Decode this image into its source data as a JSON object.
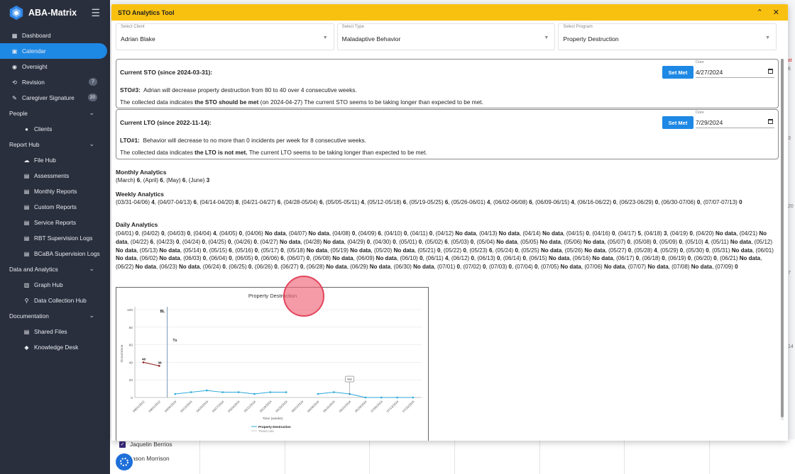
{
  "app": {
    "name": "ABA-Matrix"
  },
  "sidebar": {
    "items": [
      {
        "label": "Dashboard",
        "icon": "dashboard-icon",
        "kind": "top"
      },
      {
        "label": "Calendar",
        "icon": "calendar-icon",
        "kind": "top",
        "active": true
      },
      {
        "label": "Oversight",
        "icon": "eye-icon",
        "kind": "top"
      },
      {
        "label": "Revision",
        "icon": "revision-icon",
        "kind": "top",
        "badge": "7"
      },
      {
        "label": "Caregiver Signature",
        "icon": "signature-icon",
        "kind": "top",
        "badge": "20"
      },
      {
        "label": "People",
        "kind": "group",
        "chevron": "⌄"
      },
      {
        "label": "Clients",
        "icon": "people-icon",
        "kind": "sub"
      },
      {
        "label": "Report Hub",
        "kind": "group",
        "chevron": "⌄"
      },
      {
        "label": "File Hub",
        "icon": "cloud-icon",
        "kind": "sub"
      },
      {
        "label": "Assessments",
        "icon": "doc-icon",
        "kind": "sub"
      },
      {
        "label": "Monthly Reports",
        "icon": "report-icon",
        "kind": "sub"
      },
      {
        "label": "Custom Reports",
        "icon": "report-icon",
        "kind": "sub"
      },
      {
        "label": "Service Reports",
        "icon": "report-icon",
        "kind": "sub"
      },
      {
        "label": "RBT Supervision Logs",
        "icon": "report-icon",
        "kind": "sub"
      },
      {
        "label": "BCaBA Supervision Logs",
        "icon": "report-icon",
        "kind": "sub"
      },
      {
        "label": "Data and Analytics",
        "kind": "group",
        "chevron": "⌄"
      },
      {
        "label": "Graph Hub",
        "icon": "graph-icon",
        "kind": "sub"
      },
      {
        "label": "Data Collection Hub",
        "icon": "data-icon",
        "kind": "sub"
      },
      {
        "label": "Documentation",
        "kind": "group",
        "chevron": "⌄"
      },
      {
        "label": "Shared Files",
        "icon": "file-icon",
        "kind": "sub"
      },
      {
        "label": "Knowledge Desk",
        "icon": "graduation-icon",
        "kind": "sub"
      }
    ]
  },
  "background": {
    "staff": [
      "Jaquelin Berrios",
      "ason Morrison"
    ],
    "edge_labels": [
      "at",
      "6",
      "3",
      "20",
      "7",
      "14"
    ]
  },
  "modal": {
    "title": "STO Analytics Tool",
    "collapse_icon": "⌃",
    "close_icon": "✕",
    "selects": [
      {
        "label": "Select Client",
        "value": "Adrian Blake"
      },
      {
        "label": "Select Type",
        "value": "Maladaptive Behavior"
      },
      {
        "label": "Select Program",
        "value": "Property Destruction"
      }
    ],
    "sto": {
      "title": "Current STO (since 2024-03-31):",
      "code": "STO#3:",
      "goal": "Adrian will decrease property destruction from 80 to 40 over 4 consecutive weeks.",
      "status_prefix": "The collected data indicates ",
      "status_bold": "the STO should be met",
      "status_suffix": " (on 2024-04-27) The current STO seems to be taking longer than expected to be met.",
      "button": "Set Met",
      "date_label": "Date",
      "date_value": "4/27/2024"
    },
    "lto": {
      "title": "Current LTO (since 2022-11-14):",
      "code": "LTO#1:",
      "goal": "Behavior will decrease to no more than 0 incidents per week for 8 consecutive weeks.",
      "status_prefix": "The collected data indicates ",
      "status_bold": "the LTO is not met.",
      "status_suffix": " The current LTO seems to be taking longer than expected to be met.",
      "button": "Set Met",
      "date_label": "Date",
      "date_value": "7/29/2024"
    },
    "monthly": {
      "title": "Monthly Analytics",
      "entries": [
        {
          "k": "(March)",
          "v": "6"
        },
        {
          "k": "(April)",
          "v": "6"
        },
        {
          "k": "(May)",
          "v": "6"
        },
        {
          "k": "(June)",
          "v": "3"
        }
      ]
    },
    "weekly": {
      "title": "Weekly Analytics",
      "entries": [
        {
          "k": "(03/31-04/06)",
          "v": "4"
        },
        {
          "k": "(04/07-04/13)",
          "v": "6"
        },
        {
          "k": "(04/14-04/20)",
          "v": "8"
        },
        {
          "k": "(04/21-04/27)",
          "v": "6"
        },
        {
          "k": "(04/28-05/04)",
          "v": "6"
        },
        {
          "k": "(05/05-05/11)",
          "v": "4"
        },
        {
          "k": "(05/12-05/18)",
          "v": "6"
        },
        {
          "k": "(05/19-05/25)",
          "v": "6"
        },
        {
          "k": "(05/26-06/01)",
          "v": "4"
        },
        {
          "k": "(06/02-06/08)",
          "v": "6"
        },
        {
          "k": "(06/09-06/15)",
          "v": "4"
        },
        {
          "k": "(06/16-06/22)",
          "v": "0"
        },
        {
          "k": "(06/23-06/29)",
          "v": "0"
        },
        {
          "k": "(06/30-07/06)",
          "v": "0"
        },
        {
          "k": "(07/07-07/13)",
          "v": "0"
        }
      ]
    },
    "daily": {
      "title": "Daily Analytics",
      "entries": [
        {
          "k": "(04/01)",
          "v": "0"
        },
        {
          "k": "(04/02)",
          "v": "0"
        },
        {
          "k": "(04/03)",
          "v": "0"
        },
        {
          "k": "(04/04)",
          "v": "4"
        },
        {
          "k": "(04/05)",
          "v": "0"
        },
        {
          "k": "(04/06)",
          "v": "No data"
        },
        {
          "k": "(04/07)",
          "v": "No data"
        },
        {
          "k": "(04/08)",
          "v": "0"
        },
        {
          "k": "(04/09)",
          "v": "6"
        },
        {
          "k": "(04/10)",
          "v": "0"
        },
        {
          "k": "(04/11)",
          "v": "0"
        },
        {
          "k": "(04/12)",
          "v": "No data"
        },
        {
          "k": "(04/13)",
          "v": "No data"
        },
        {
          "k": "(04/14)",
          "v": "No data"
        },
        {
          "k": "(04/15)",
          "v": "0"
        },
        {
          "k": "(04/16)",
          "v": "0"
        },
        {
          "k": "(04/17)",
          "v": "5"
        },
        {
          "k": "(04/18)",
          "v": "3"
        },
        {
          "k": "(04/19)",
          "v": "0"
        },
        {
          "k": "(04/20)",
          "v": "No data"
        },
        {
          "k": "(04/21)",
          "v": "No data"
        },
        {
          "k": "(04/22)",
          "v": "6"
        },
        {
          "k": "(04/23)",
          "v": "0"
        },
        {
          "k": "(04/24)",
          "v": "0"
        },
        {
          "k": "(04/25)",
          "v": "0"
        },
        {
          "k": "(04/26)",
          "v": "0"
        },
        {
          "k": "(04/27)",
          "v": "No data"
        },
        {
          "k": "(04/28)",
          "v": "No data"
        },
        {
          "k": "(04/29)",
          "v": "0"
        },
        {
          "k": "(04/30)",
          "v": "0"
        },
        {
          "k": "(05/01)",
          "v": "0"
        },
        {
          "k": "(05/02)",
          "v": "6"
        },
        {
          "k": "(05/03)",
          "v": "0"
        },
        {
          "k": "(05/04)",
          "v": "No data"
        },
        {
          "k": "(05/05)",
          "v": "No data"
        },
        {
          "k": "(05/06)",
          "v": "No data"
        },
        {
          "k": "(05/07)",
          "v": "0"
        },
        {
          "k": "(05/08)",
          "v": "0"
        },
        {
          "k": "(05/09)",
          "v": "0"
        },
        {
          "k": "(05/10)",
          "v": "4"
        },
        {
          "k": "(05/11)",
          "v": "No data"
        },
        {
          "k": "(05/12)",
          "v": "No data"
        },
        {
          "k": "(05/13)",
          "v": "No data"
        },
        {
          "k": "(05/14)",
          "v": "0"
        },
        {
          "k": "(05/15)",
          "v": "6"
        },
        {
          "k": "(05/16)",
          "v": "0"
        },
        {
          "k": "(05/17)",
          "v": "0"
        },
        {
          "k": "(05/18)",
          "v": "No data"
        },
        {
          "k": "(05/19)",
          "v": "No data"
        },
        {
          "k": "(05/20)",
          "v": "No data"
        },
        {
          "k": "(05/21)",
          "v": "0"
        },
        {
          "k": "(05/22)",
          "v": "0"
        },
        {
          "k": "(05/23)",
          "v": "6"
        },
        {
          "k": "(05/24)",
          "v": "0"
        },
        {
          "k": "(05/25)",
          "v": "No data"
        },
        {
          "k": "(05/26)",
          "v": "No data"
        },
        {
          "k": "(05/27)",
          "v": "0"
        },
        {
          "k": "(05/28)",
          "v": "4"
        },
        {
          "k": "(05/29)",
          "v": "0"
        },
        {
          "k": "(05/30)",
          "v": "0"
        },
        {
          "k": "(05/31)",
          "v": "No data"
        },
        {
          "k": "(06/01)",
          "v": "No data"
        },
        {
          "k": "(06/02)",
          "v": "No data"
        },
        {
          "k": "(06/03)",
          "v": "0"
        },
        {
          "k": "(06/04)",
          "v": "0"
        },
        {
          "k": "(06/05)",
          "v": "0"
        },
        {
          "k": "(06/06)",
          "v": "6"
        },
        {
          "k": "(06/07)",
          "v": "0"
        },
        {
          "k": "(06/08)",
          "v": "No data"
        },
        {
          "k": "(06/09)",
          "v": "No data"
        },
        {
          "k": "(06/10)",
          "v": "0"
        },
        {
          "k": "(06/11)",
          "v": "4"
        },
        {
          "k": "(06/12)",
          "v": "0"
        },
        {
          "k": "(06/13)",
          "v": "0"
        },
        {
          "k": "(06/14)",
          "v": "0"
        },
        {
          "k": "(06/15)",
          "v": "No data"
        },
        {
          "k": "(06/16)",
          "v": "No data"
        },
        {
          "k": "(06/17)",
          "v": "0"
        },
        {
          "k": "(06/18)",
          "v": "0"
        },
        {
          "k": "(06/19)",
          "v": "0"
        },
        {
          "k": "(06/20)",
          "v": "0"
        },
        {
          "k": "(06/21)",
          "v": "No data"
        },
        {
          "k": "(06/22)",
          "v": "No data"
        },
        {
          "k": "(06/23)",
          "v": "No data"
        },
        {
          "k": "(06/24)",
          "v": "0"
        },
        {
          "k": "(06/25)",
          "v": "0"
        },
        {
          "k": "(06/26)",
          "v": "0"
        },
        {
          "k": "(06/27)",
          "v": "0"
        },
        {
          "k": "(06/28)",
          "v": "No data"
        },
        {
          "k": "(06/29)",
          "v": "No data"
        },
        {
          "k": "(06/30)",
          "v": "No data"
        },
        {
          "k": "(07/01)",
          "v": "0"
        },
        {
          "k": "(07/02)",
          "v": "0"
        },
        {
          "k": "(07/03)",
          "v": "0"
        },
        {
          "k": "(07/04)",
          "v": "0"
        },
        {
          "k": "(07/05)",
          "v": "No data"
        },
        {
          "k": "(07/06)",
          "v": "No data"
        },
        {
          "k": "(07/07)",
          "v": "No data"
        },
        {
          "k": "(07/08)",
          "v": "No data"
        },
        {
          "k": "(07/09)",
          "v": "0"
        }
      ]
    }
  },
  "chart_data": {
    "type": "line",
    "title": "Property Destruction",
    "xlabel": "Time (weeks)",
    "ylabel": "Occurrence",
    "ylim": [
      0,
      100
    ],
    "yticks": [
      0,
      20,
      40,
      60,
      80,
      100
    ],
    "x": [
      "08/01/2022",
      "09/01/2022",
      "04/06/2024",
      "04/13/2024",
      "04/20/2024",
      "04/27/2024",
      "05/04/2024",
      "05/11/2024",
      "05/18/2024",
      "05/25/2024",
      "06/01/2024",
      "06/08/2024",
      "06/15/2024",
      "06/22/2024",
      "06/29/2024",
      "07/06/2024",
      "07/13/2024",
      "07/20/2024"
    ],
    "phase_labels": [
      "BL",
      "Tx"
    ],
    "phase_line_after_index": 1,
    "series": [
      {
        "name": "Property Destruction",
        "color": "#2aa8d8",
        "start_index": 2,
        "values": [
          4,
          6,
          8,
          6,
          6,
          4,
          6,
          6,
          null,
          4,
          6,
          4,
          0,
          0,
          0,
          0
        ]
      },
      {
        "name": "",
        "color": "#8b1a1a",
        "start_index": 0,
        "values": [
          40,
          36
        ],
        "labels": [
          "40",
          "36"
        ]
      }
    ],
    "annotation": "Met",
    "legend": [
      "Property Destruction",
      "Trend Line"
    ],
    "grid": true
  },
  "colors": {
    "header": "#f9c10f",
    "accent": "#1e88e5",
    "sidebar": "#2a2f3d"
  }
}
